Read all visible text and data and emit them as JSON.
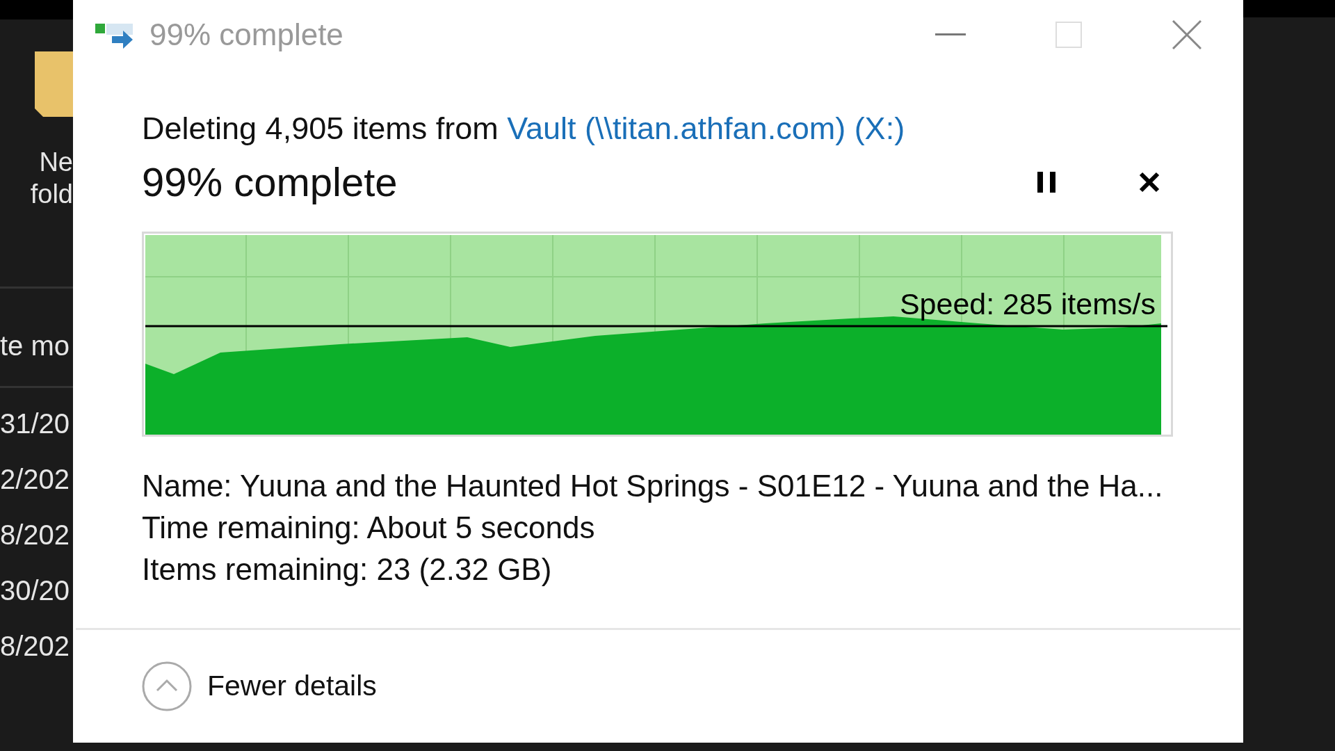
{
  "background": {
    "folder_label": [
      "Ne",
      "fold"
    ],
    "column_header": "te mo",
    "dates": [
      "31/20",
      "2/202",
      "8/202",
      "30/20",
      "8/202"
    ]
  },
  "window": {
    "title": "99% complete"
  },
  "operation": {
    "prefix": "Deleting 4,905 items from",
    "link": "Vault (\\\\titan.athfan.com) (X:)"
  },
  "progress": {
    "heading": "99% complete",
    "speed": "Speed: 285 items/s"
  },
  "details": [
    {
      "label": "Name:",
      "value": "Yuuna and the Haunted Hot Springs - S01E12 - Yuuna and the Ha..."
    },
    {
      "label": "Time remaining:",
      "value": "About 5 seconds"
    },
    {
      "label": "Items remaining:",
      "value": "23 (2.32 GB)"
    }
  ],
  "toggle": {
    "label": "Fewer details",
    "expanded": true
  }
}
